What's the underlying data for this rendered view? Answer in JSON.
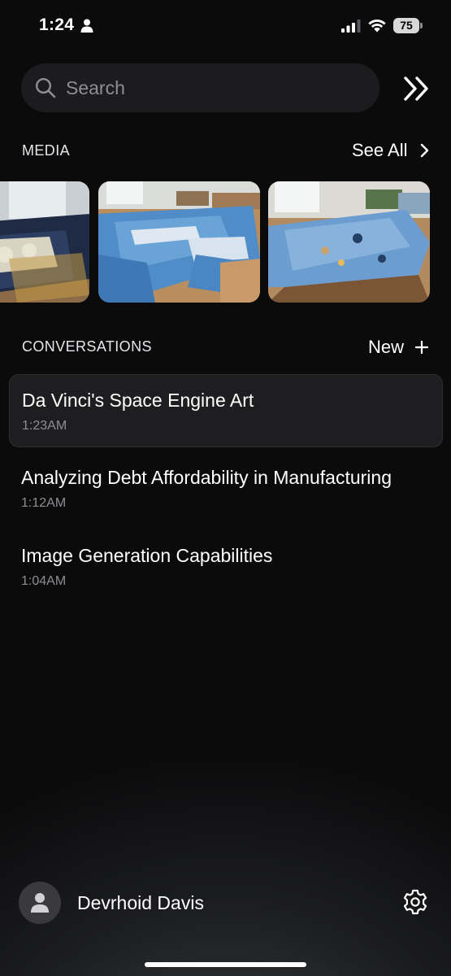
{
  "status_bar": {
    "time": "1:24",
    "battery": "75"
  },
  "search": {
    "placeholder": "Search"
  },
  "media": {
    "title": "MEDIA",
    "see_all_label": "See All"
  },
  "conversations": {
    "title": "CONVERSATIONS",
    "new_label": "New",
    "items": [
      {
        "title": "Da Vinci's Space Engine Art",
        "time": "1:23AM"
      },
      {
        "title": "Analyzing Debt Affordability in Manufacturing",
        "time": "1:12AM"
      },
      {
        "title": "Image Generation Capabilities",
        "time": "1:04AM"
      }
    ]
  },
  "user": {
    "name": "Devrhoid Davis"
  },
  "colors": {
    "background": "#0b0b0c",
    "search_field": "#1c1c1e",
    "secondary_text": "#8e8e93",
    "selected_row": "#1e1e20"
  },
  "icons": [
    "person-icon",
    "cellular-signal-icon",
    "wifi-icon",
    "battery-icon",
    "search-icon",
    "double-chevron-right-icon",
    "chevron-right-icon",
    "plus-icon",
    "avatar-person-icon",
    "gear-icon"
  ]
}
